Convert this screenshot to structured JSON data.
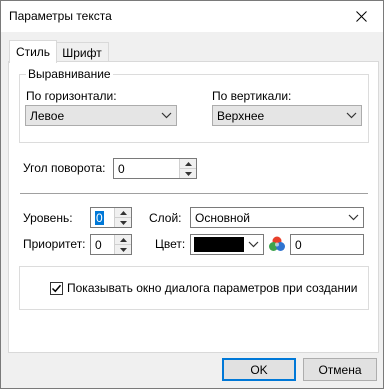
{
  "window": {
    "title": "Параметры текста"
  },
  "tabs": [
    {
      "label": "Стиль",
      "active": true
    },
    {
      "label": "Шрифт",
      "active": false
    }
  ],
  "alignment": {
    "group_title": "Выравнивание",
    "horizontal_label": "По горизонтали:",
    "horizontal_value": "Левое",
    "vertical_label": "По вертикали:",
    "vertical_value": "Верхнее"
  },
  "rotation": {
    "label": "Угол поворота:",
    "value": "0"
  },
  "level": {
    "label": "Уровень:",
    "value": "0"
  },
  "layer": {
    "label": "Слой:",
    "value": "Основной"
  },
  "priority": {
    "label": "Приоритет:",
    "value": "0"
  },
  "color": {
    "label": "Цвет:",
    "swatch": "#000000",
    "value": "0"
  },
  "show_dialog": {
    "label": "Показывать окно диалога параметров при создании",
    "checked": true
  },
  "buttons": {
    "ok": "OK",
    "cancel": "Отмена"
  },
  "colors": {
    "accent": "#0078d7",
    "page_bg": "#ffffff",
    "dialog_bg": "#f0f0f0"
  }
}
